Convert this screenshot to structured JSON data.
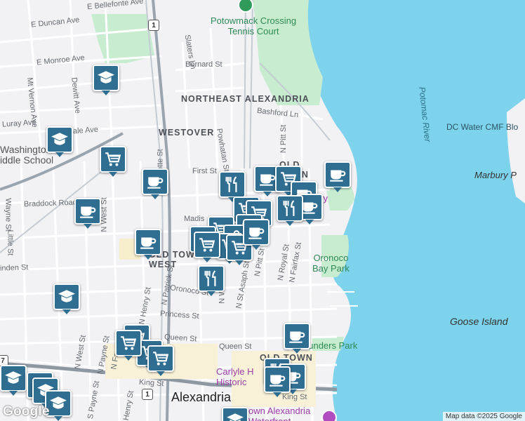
{
  "map": {
    "streets": [
      {
        "id": "e-bellefonte-ave",
        "text": "E Bellefonte Ave"
      },
      {
        "id": "e-duncan-ave",
        "text": "E Duncan Ave"
      },
      {
        "id": "e-monroe-ave",
        "text": "E Monroe Ave"
      },
      {
        "id": "mt-vernon-ave",
        "text": "Mt Vernon Ave"
      },
      {
        "id": "dewitt-ave",
        "text": "Dewitt Ave"
      },
      {
        "id": "luray-ave",
        "text": "Luray Ave"
      },
      {
        "id": "ale-ave",
        "text": "ale Ave"
      },
      {
        "id": "slaters-ln",
        "text": "Slaters Ln"
      },
      {
        "id": "bernard-st",
        "text": "Bernard St"
      },
      {
        "id": "bashford-ln",
        "text": "Bashford Ln"
      },
      {
        "id": "powhatan-st",
        "text": "Powhatan St"
      },
      {
        "id": "first-st",
        "text": "First St"
      },
      {
        "id": "n-pitt-st-top",
        "text": "N Pitt St"
      },
      {
        "id": "braddock-rd",
        "text": "Braddock Road"
      },
      {
        "id": "fayette-st",
        "text": "ayette St"
      },
      {
        "id": "n-west-st",
        "text": "N West St"
      },
      {
        "id": "wayne-st",
        "text": "Wayne St"
      },
      {
        "id": "little-st",
        "text": "Little St"
      },
      {
        "id": "linden-st",
        "text": "inden St"
      },
      {
        "id": "madison",
        "text": "Madis"
      },
      {
        "id": "n-henry-st",
        "text": "N Henry St"
      },
      {
        "id": "n-patrick-st",
        "text": "N Patrick St"
      },
      {
        "id": "oronoco-st",
        "text": "Oronoco St"
      },
      {
        "id": "n-washington",
        "text": "N W"
      },
      {
        "id": "n-st-asaph-st",
        "text": "N St Asaph St"
      },
      {
        "id": "n-pitt-st",
        "text": "N Pitt St"
      },
      {
        "id": "n-royal-st",
        "text": "N Royal St"
      },
      {
        "id": "n-fairfax-st",
        "text": "N Fairfax St"
      },
      {
        "id": "princess-st",
        "text": "Princess St"
      },
      {
        "id": "queen-st-west",
        "text": "Queen St"
      },
      {
        "id": "queen-st-east",
        "text": "Queen St"
      },
      {
        "id": "n-west-st-south",
        "text": "N West St"
      },
      {
        "id": "n-payne-st",
        "text": "N Payne St"
      },
      {
        "id": "n-fayette",
        "text": "N Fay"
      },
      {
        "id": "s-payne-st",
        "text": "S Payne St"
      },
      {
        "id": "king-st",
        "text": "King St"
      },
      {
        "id": "king-st-east",
        "text": "King St"
      },
      {
        "id": "henry-st",
        "text": "Henry St"
      }
    ],
    "neighborhoods": [
      {
        "id": "northeast-alexandria",
        "text": "NORTHEAST\nALEXANDRIA"
      },
      {
        "id": "westover",
        "text": "WESTOVER"
      },
      {
        "id": "old-town-north",
        "text": "OLD TOWN\nNORTH"
      },
      {
        "id": "old-town-west",
        "text": "OLD TOWN\nWEST"
      },
      {
        "id": "old-town",
        "text": "OLD TOWN"
      }
    ],
    "places": [
      {
        "id": "potowmack-crossing",
        "text": "Potowmack Crossing\nTennis Court",
        "kind": "park"
      },
      {
        "id": "washington-middle-school",
        "text": "Washington\niddle School",
        "kind": "school"
      },
      {
        "id": "oronoco-bay-park",
        "text": "Oronoco\nBay Park",
        "kind": "park"
      },
      {
        "id": "founders-park",
        "text": "ounders Park",
        "kind": "park"
      },
      {
        "id": "carlyle-historic",
        "text": "Carlyle H\nHistoric",
        "kind": "poi"
      },
      {
        "id": "alexandria-waterfront",
        "text": "own Alexandria\nWaterfront",
        "kind": "poi"
      },
      {
        "id": "ery",
        "text": "ery",
        "kind": "poi"
      }
    ],
    "water": [
      {
        "id": "potomac-river",
        "text": "Potomac River"
      },
      {
        "id": "dc-water",
        "text": "DC Water CMF Blo"
      },
      {
        "id": "marbury",
        "text": "Marbury P"
      }
    ],
    "islands": [
      {
        "id": "goose-island",
        "text": "Goose Island"
      }
    ],
    "city": "Alexandria",
    "route_shields": [
      {
        "id": "route-1-north",
        "text": "1"
      },
      {
        "id": "route-1-south",
        "text": "1"
      },
      {
        "id": "route-7",
        "text": "7"
      }
    ],
    "logo": "Google",
    "attribution": "Map data ©2025 Google",
    "colors": {
      "water": "#7dd3ec",
      "park": "#c8ecd0",
      "pin": "#2f6d91",
      "land": "#f2f1f4",
      "rail": "#9aa4ae"
    },
    "markers": [
      {
        "icon": "school"
      },
      {
        "icon": "school"
      },
      {
        "icon": "cart"
      },
      {
        "icon": "cup"
      },
      {
        "icon": "cup"
      },
      {
        "icon": "cup"
      },
      {
        "icon": "cup"
      },
      {
        "icon": "fork-knife"
      },
      {
        "icon": "cup"
      },
      {
        "icon": "cart"
      },
      {
        "icon": "cup"
      },
      {
        "icon": "cart"
      },
      {
        "icon": "cup"
      },
      {
        "icon": "fork-knife"
      },
      {
        "icon": "cart"
      },
      {
        "icon": "cup"
      },
      {
        "icon": "cart"
      },
      {
        "icon": "bag"
      },
      {
        "icon": "cup"
      },
      {
        "icon": "cart"
      },
      {
        "icon": "cart"
      },
      {
        "icon": "fork-knife"
      },
      {
        "icon": "cup"
      },
      {
        "icon": "fork-knife"
      },
      {
        "icon": "cart"
      },
      {
        "icon": "school"
      },
      {
        "icon": "school"
      },
      {
        "icon": "cart"
      },
      {
        "icon": "cart"
      },
      {
        "icon": "cart"
      },
      {
        "icon": "cup"
      },
      {
        "icon": "cart"
      },
      {
        "icon": "cup"
      },
      {
        "icon": "cup"
      },
      {
        "icon": "school"
      },
      {
        "icon": "school"
      },
      {
        "icon": "school"
      },
      {
        "icon": "school"
      }
    ]
  }
}
